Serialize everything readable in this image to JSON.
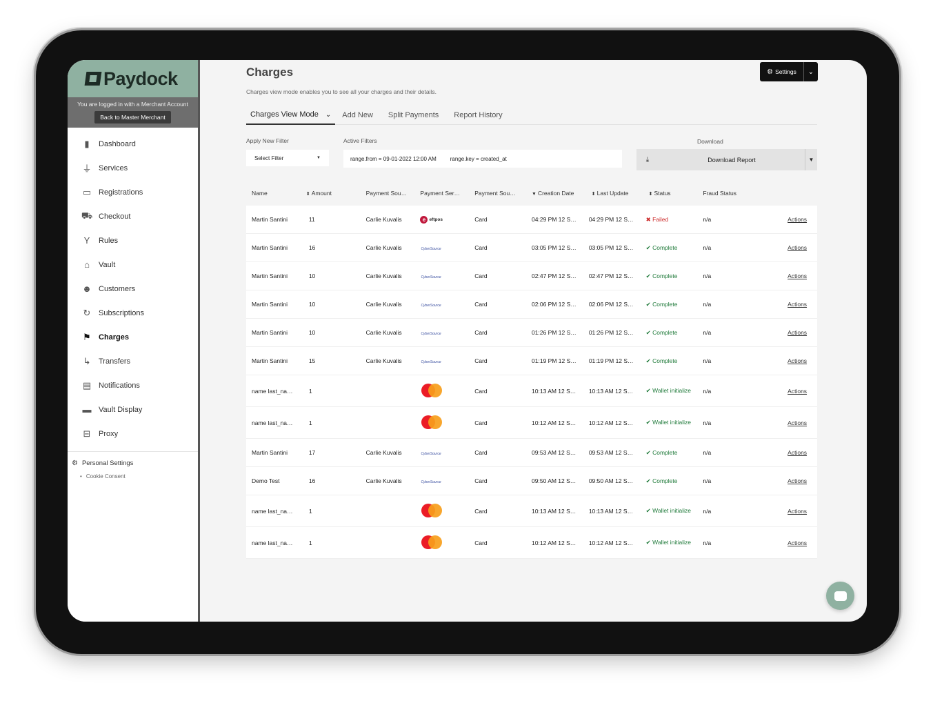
{
  "brand": {
    "name": "Paydock"
  },
  "merchant": {
    "note": "You are logged in with a Merchant Account",
    "back_label": "Back to Master Merchant"
  },
  "nav": {
    "items": [
      {
        "label": "Dashboard",
        "icon": "bar-chart-icon"
      },
      {
        "label": "Services",
        "icon": "plug-icon"
      },
      {
        "label": "Registrations",
        "icon": "monitor-icon"
      },
      {
        "label": "Checkout",
        "icon": "cart-icon"
      },
      {
        "label": "Rules",
        "icon": "split-arrow-icon"
      },
      {
        "label": "Vault",
        "icon": "bank-icon"
      },
      {
        "label": "Customers",
        "icon": "users-icon"
      },
      {
        "label": "Subscriptions",
        "icon": "refresh-icon"
      },
      {
        "label": "Charges",
        "icon": "flag-icon",
        "active": true
      },
      {
        "label": "Transfers",
        "icon": "turn-right-icon"
      },
      {
        "label": "Notifications",
        "icon": "chat-icon"
      },
      {
        "label": "Vault Display",
        "icon": "card-icon"
      },
      {
        "label": "Proxy",
        "icon": "proxy-icon"
      }
    ],
    "personal_settings": "Personal Settings",
    "cookie_consent": "Cookie Consent"
  },
  "header": {
    "title": "Charges",
    "subtitle": "Charges view mode enables you to see all your charges and their details.",
    "settings_label": "Settings"
  },
  "tabs": [
    {
      "label": "Charges View Mode",
      "active": true
    },
    {
      "label": "Add New"
    },
    {
      "label": "Split Payments"
    },
    {
      "label": "Report History"
    }
  ],
  "filters": {
    "apply_label": "Apply New Filter",
    "select_placeholder": "Select Filter",
    "active_label": "Active Filters",
    "chips": [
      "range.from = 09-01-2022 12:00 AM",
      "range.key = created_at"
    ]
  },
  "download": {
    "label": "Download",
    "button": "Download Report"
  },
  "table": {
    "headers": [
      "Name",
      "Amount",
      "Payment Sou…",
      "Payment Ser…",
      "Payment Sou…",
      "Creation Date",
      "Last Update",
      "Status",
      "Fraud Status",
      ""
    ],
    "rows": [
      {
        "name": "Martin Santini",
        "amount": "11",
        "source": "Carlie Kuvalis",
        "service": "eftpos",
        "type": "Card",
        "created": "04:29 PM 12 S…",
        "updated": "04:29 PM 12 S…",
        "status": "Failed",
        "status_kind": "fail",
        "fraud": "n/a",
        "action": "Actions"
      },
      {
        "name": "Martin Santini",
        "amount": "16",
        "source": "Carlie Kuvalis",
        "service": "cybersource",
        "type": "Card",
        "created": "03:05 PM 12 S…",
        "updated": "03:05 PM 12 S…",
        "status": "Complete",
        "status_kind": "ok",
        "fraud": "n/a",
        "action": "Actions"
      },
      {
        "name": "Martin Santini",
        "amount": "10",
        "source": "Carlie Kuvalis",
        "service": "cybersource",
        "type": "Card",
        "created": "02:47 PM 12 S…",
        "updated": "02:47 PM 12 S…",
        "status": "Complete",
        "status_kind": "ok",
        "fraud": "n/a",
        "action": "Actions"
      },
      {
        "name": "Martin Santini",
        "amount": "10",
        "source": "Carlie Kuvalis",
        "service": "cybersource",
        "type": "Card",
        "created": "02:06 PM 12 S…",
        "updated": "02:06 PM 12 S…",
        "status": "Complete",
        "status_kind": "ok",
        "fraud": "n/a",
        "action": "Actions"
      },
      {
        "name": "Martin Santini",
        "amount": "10",
        "source": "Carlie Kuvalis",
        "service": "cybersource",
        "type": "Card",
        "created": "01:26 PM 12 S…",
        "updated": "01:26 PM 12 S…",
        "status": "Complete",
        "status_kind": "ok",
        "fraud": "n/a",
        "action": "Actions"
      },
      {
        "name": "Martin Santini",
        "amount": "15",
        "source": "Carlie Kuvalis",
        "service": "cybersource",
        "type": "Card",
        "created": "01:19 PM 12 S…",
        "updated": "01:19 PM 12 S…",
        "status": "Complete",
        "status_kind": "ok",
        "fraud": "n/a",
        "action": "Actions"
      },
      {
        "name": "name last_na…",
        "amount": "1",
        "source": "",
        "service": "mastercard",
        "type": "Card",
        "created": "10:13 AM 12 S…",
        "updated": "10:13 AM 12 S…",
        "status": "Wallet initialize",
        "status_kind": "ok",
        "fraud": "n/a",
        "action": "Actions"
      },
      {
        "name": "name last_na…",
        "amount": "1",
        "source": "",
        "service": "mastercard",
        "type": "Card",
        "created": "10:12 AM 12 S…",
        "updated": "10:12 AM 12 S…",
        "status": "Wallet initialize",
        "status_kind": "ok",
        "fraud": "n/a",
        "action": "Actions"
      },
      {
        "name": "Martin Santini",
        "amount": "17",
        "source": "Carlie Kuvalis",
        "service": "cybersource",
        "type": "Card",
        "created": "09:53 AM 12 S…",
        "updated": "09:53 AM 12 S…",
        "status": "Complete",
        "status_kind": "ok",
        "fraud": "n/a",
        "action": "Actions"
      },
      {
        "name": "Demo Test",
        "amount": "16",
        "source": "Carlie Kuvalis",
        "service": "cybersource",
        "type": "Card",
        "created": "09:50 AM 12 S…",
        "updated": "09:50 AM 12 S…",
        "status": "Complete",
        "status_kind": "ok",
        "fraud": "n/a",
        "action": "Actions"
      },
      {
        "name": "name last_na…",
        "amount": "1",
        "source": "",
        "service": "mastercard",
        "type": "Card",
        "created": "10:13 AM 12 S…",
        "updated": "10:13 AM 12 S…",
        "status": "Wallet initialize",
        "status_kind": "ok",
        "fraud": "n/a",
        "action": "Actions"
      },
      {
        "name": "name last_na…",
        "amount": "1",
        "source": "",
        "service": "mastercard",
        "type": "Card",
        "created": "10:12 AM 12 S…",
        "updated": "10:12 AM 12 S…",
        "status": "Wallet initialize",
        "status_kind": "ok",
        "fraud": "n/a",
        "action": "Actions"
      }
    ]
  },
  "colors": {
    "brand": "#8fb1a1",
    "ok": "#1f7a3a",
    "fail": "#cc2a2a"
  }
}
